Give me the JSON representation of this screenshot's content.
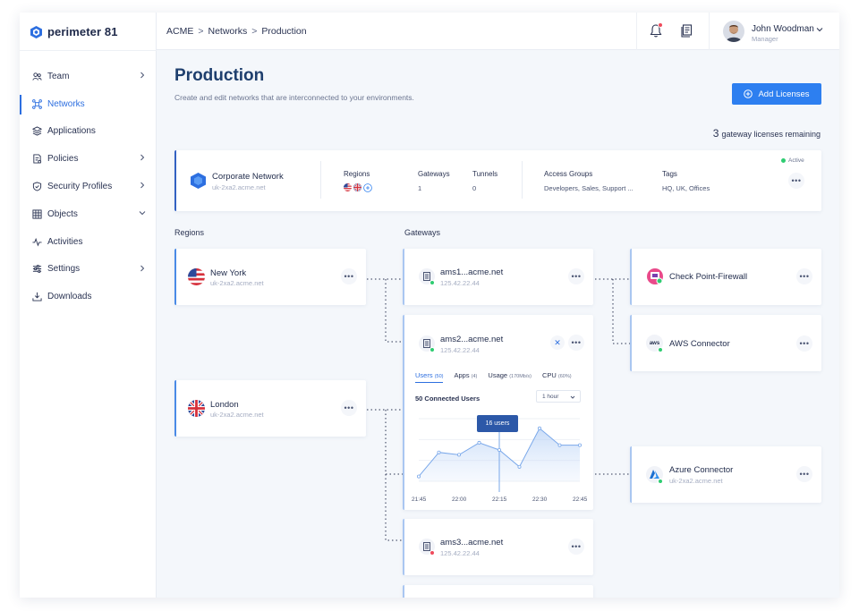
{
  "app": {
    "name": "perimeter 81"
  },
  "sidebar": {
    "items": [
      {
        "label": "Team",
        "icon": "team-icon",
        "chevron": "right"
      },
      {
        "label": "Networks",
        "icon": "networks-icon",
        "active": true
      },
      {
        "label": "Applications",
        "icon": "applications-icon"
      },
      {
        "label": "Policies",
        "icon": "policies-icon",
        "chevron": "right"
      },
      {
        "label": "Security Profiles",
        "icon": "shield-icon",
        "chevron": "right"
      },
      {
        "label": "Objects",
        "icon": "objects-icon",
        "chevron": "down"
      },
      {
        "label": "Activities",
        "icon": "activities-icon"
      },
      {
        "label": "Settings",
        "icon": "sliders-icon",
        "chevron": "right"
      },
      {
        "label": "Downloads",
        "icon": "download-icon"
      }
    ]
  },
  "breadcrumb": {
    "items": [
      "ACME",
      "Networks",
      "Production"
    ],
    "separator": ">"
  },
  "user": {
    "name": "John Woodman",
    "role": "Manager"
  },
  "page": {
    "title": "Production",
    "subtitle": "Create and edit networks that are interconnected to your environments.",
    "add_button": "Add Licenses",
    "licenses_count": "3",
    "licenses_text": "gateway licenses remaining"
  },
  "network": {
    "name": "Corporate Network",
    "host": "uk-2xa2.acme.net",
    "status": "Active",
    "columns": {
      "regions": "Regions",
      "gateways": "Gateways",
      "gateways_value": "1",
      "tunnels": "Tunnels",
      "tunnels_value": "0",
      "access_groups": "Access Groups",
      "access_groups_value": "Developers, Sales, Support ...",
      "tags": "Tags",
      "tags_value": "HQ, UK, Offices"
    }
  },
  "sections": {
    "regions": "Regions",
    "gateways": "Gateways"
  },
  "regions": [
    {
      "name": "New York",
      "host": "uk-2xa2.acme.net",
      "flag": "us-flag"
    },
    {
      "name": "London",
      "host": "uk-2xa2.acme.net",
      "flag": "uk-flag"
    }
  ],
  "gateways": [
    {
      "name": "ams1...acme.net",
      "ip": "125.42.22.44",
      "status_color": "#2ecc71"
    },
    {
      "name": "ams2...acme.net",
      "ip": "125.42.22.44",
      "status_color": "#2ecc71"
    },
    {
      "name": "ams3...acme.net",
      "ip": "125.42.22.44",
      "status_color": "#ef4a5b"
    }
  ],
  "gateway_detail": {
    "tabs": [
      {
        "label": "Users",
        "count": "(50)",
        "active": true
      },
      {
        "label": "Apps",
        "count": "(4)"
      },
      {
        "label": "Usage",
        "count": "(170Mb/s)"
      },
      {
        "label": "CPU",
        "count": "(60%)"
      }
    ],
    "connected_label": "50 Connected Users",
    "range": "1 hour",
    "tooltip": "16 users"
  },
  "connectors": [
    {
      "name": "Check Point-Firewall",
      "icon": "checkpoint-icon",
      "host": ""
    },
    {
      "name": "AWS Connector",
      "icon": "aws-icon",
      "host": "",
      "badge": "aws"
    },
    {
      "name": "Azure Connector",
      "icon": "azure-icon",
      "host": "uk-2xa2.acme.net"
    }
  ],
  "colors": {
    "accent": "#2d7ff0",
    "active": "#2ecc71",
    "error": "#ef4a5b",
    "title": "#1f3f6e"
  },
  "chart_data": {
    "type": "area",
    "x": [
      "21:45",
      "21:52",
      "22:00",
      "22:07",
      "22:15",
      "22:22",
      "22:30",
      "22:37",
      "22:45"
    ],
    "values": [
      2,
      12,
      11,
      16,
      13,
      6,
      22,
      15,
      15
    ],
    "xticks": [
      "21:45",
      "22:00",
      "22:15",
      "22:30",
      "22:45"
    ],
    "highlight_x": "22:15",
    "ylim": [
      0,
      26
    ],
    "grid": true
  }
}
